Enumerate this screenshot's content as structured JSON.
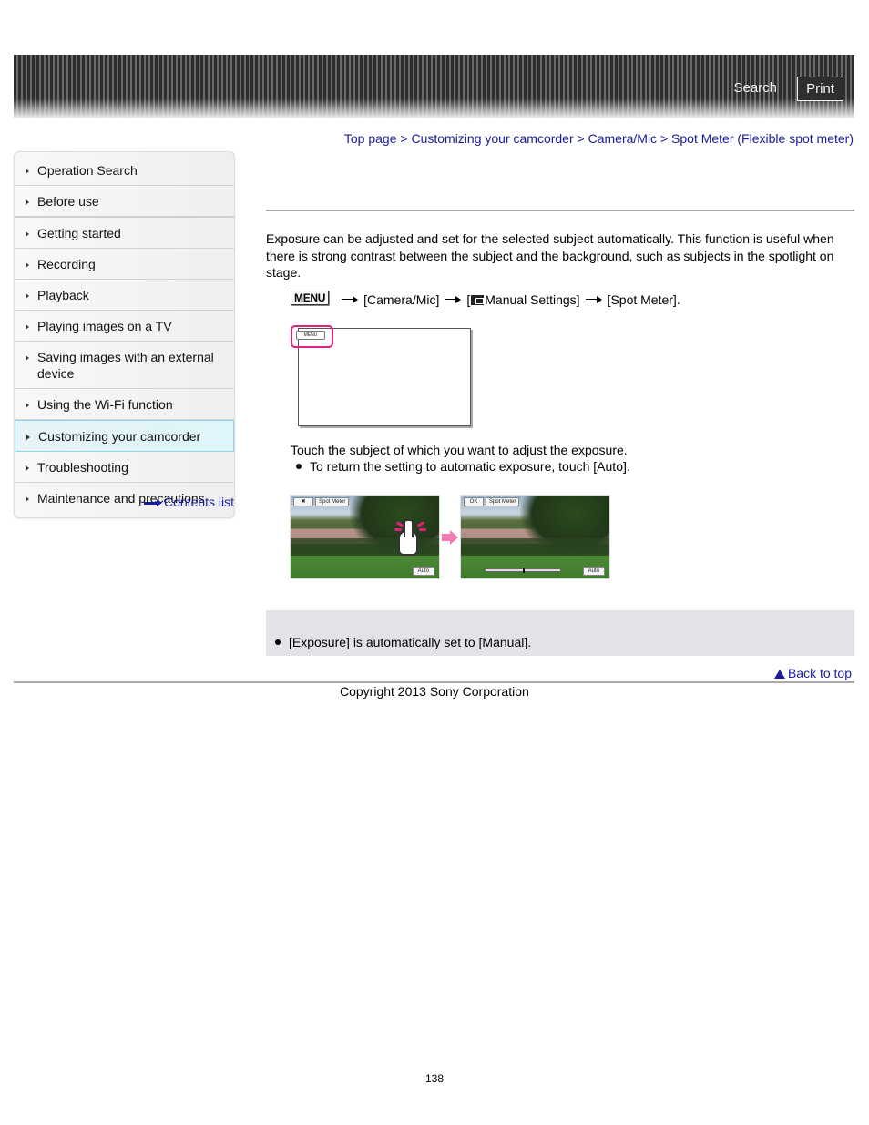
{
  "header": {
    "search_label": "Search",
    "print_label": "Print"
  },
  "breadcrumb": {
    "items": [
      "Top page",
      "Customizing your camcorder",
      "Camera/Mic",
      "Spot Meter (Flexible spot meter)"
    ],
    "separator": ">"
  },
  "sidebar": {
    "items": [
      {
        "label": "Operation Search",
        "active": false
      },
      {
        "label": "Before use",
        "active": false
      },
      {
        "label": "Getting started",
        "active": false
      },
      {
        "label": "Recording",
        "active": false
      },
      {
        "label": "Playback",
        "active": false
      },
      {
        "label": "Playing images on a TV",
        "active": false
      },
      {
        "label": "Saving images with an external device",
        "active": false
      },
      {
        "label": "Using the Wi-Fi function",
        "active": false
      },
      {
        "label": "Customizing your camcorder",
        "active": true
      },
      {
        "label": "Troubleshooting",
        "active": false
      },
      {
        "label": "Maintenance and precautions",
        "active": false
      }
    ],
    "contents_link": "Contents list",
    "active_color": "#8fd6ea"
  },
  "main": {
    "intro": "Exposure can be adjusted and set for the selected subject automatically. This function is useful when there is strong contrast between the subject and the background, such as subjects in the spotlight on stage.",
    "menu_path": {
      "menu_button": "MENU",
      "step1": "[Camera/Mic]",
      "step2_open": "[",
      "step2": "Manual Settings]",
      "step3": "[Spot Meter]."
    },
    "diagram": {
      "menu_button": "MENU",
      "highlight_color": "#e0217b"
    },
    "step_text": "Touch the subject of which you want to adjust the exposure.",
    "step_bullet": "To return the setting to automatic exposure, touch [Auto].",
    "photos": [
      {
        "close_label": "✖",
        "title_label": "Spot Meter",
        "auto_label": "Auto"
      },
      {
        "close_label": "OK",
        "title_label": "Spot Meter",
        "auto_label": "Auto"
      }
    ],
    "note": "[Exposure] is automatically set to [Manual]."
  },
  "footer": {
    "back_to_top": "Back to top",
    "copyright": "Copyright 2013 Sony Corporation",
    "page_number": "138"
  },
  "colors": {
    "link": "#1a1a9c",
    "note_bg": "#e1e3e7",
    "accent_pink": "#e0217b"
  }
}
